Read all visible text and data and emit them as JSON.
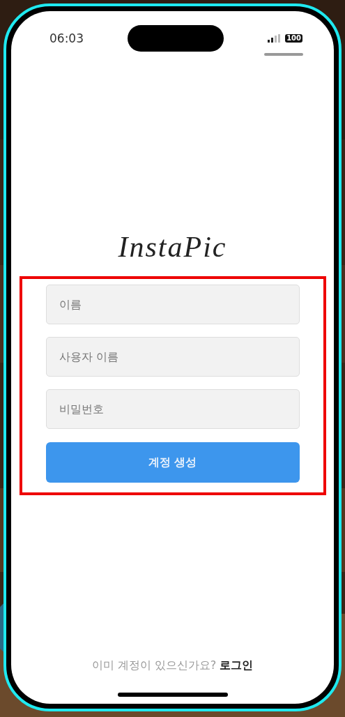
{
  "status_bar": {
    "time": "06:03",
    "battery": "100"
  },
  "logo": "InstaPic",
  "form": {
    "fields": [
      {
        "placeholder": "이름"
      },
      {
        "placeholder": "사용자 이름"
      },
      {
        "placeholder": "비밀번호"
      }
    ],
    "submit": "계정 생성"
  },
  "footer": {
    "prompt": "이미 계정이 있으신가요?",
    "link": "로그인"
  }
}
